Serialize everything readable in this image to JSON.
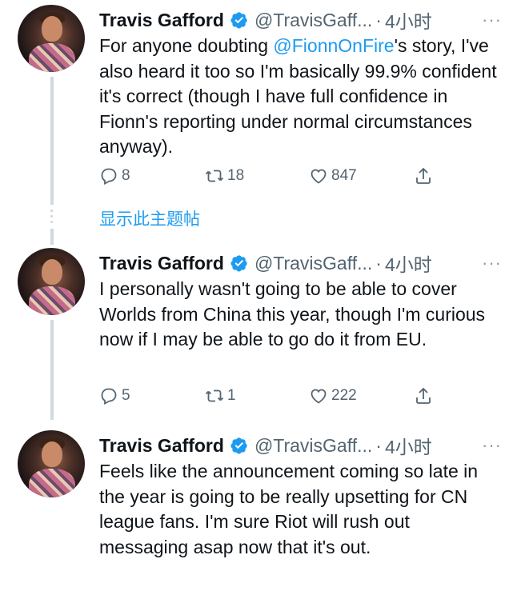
{
  "show_thread_label": "显示此主题帖",
  "tweets": [
    {
      "name": "Travis Gafford",
      "handle": "@TravisGaff...",
      "separator": "·",
      "time": "4小时",
      "more": "···",
      "text_before": "For anyone doubting ",
      "mention": "@FionnOnFire",
      "text_after": "'s story, I've also heard it too so I'm basically 99.9% confident it's correct (though I have full confidence in Fionn's reporting under normal circumstances anyway).",
      "replies": "8",
      "retweets": "18",
      "likes": "847"
    },
    {
      "name": "Travis Gafford",
      "handle": "@TravisGaff...",
      "separator": "·",
      "time": "4小时",
      "more": "···",
      "text": "I personally wasn't going to be able to cover Worlds from China this year, though I'm curious now if I may be able to go do it from EU.",
      "replies": "5",
      "retweets": "1",
      "likes": "222"
    },
    {
      "name": "Travis Gafford",
      "handle": "@TravisGaff...",
      "separator": "·",
      "time": "4小时",
      "more": "···",
      "text": "Feels like the announcement coming so late in the year is going to be really upsetting for CN league fans. I'm sure Riot will rush out messaging asap now that it's out."
    }
  ],
  "colors": {
    "link": "#1d9bf0",
    "secondary_text": "#536471",
    "verified_badge": "#1d9bf0",
    "thread_line": "#cfd9de"
  },
  "icons": [
    "reply-icon",
    "retweet-icon",
    "like-icon",
    "share-icon",
    "verified-badge-icon",
    "more-icon"
  ]
}
